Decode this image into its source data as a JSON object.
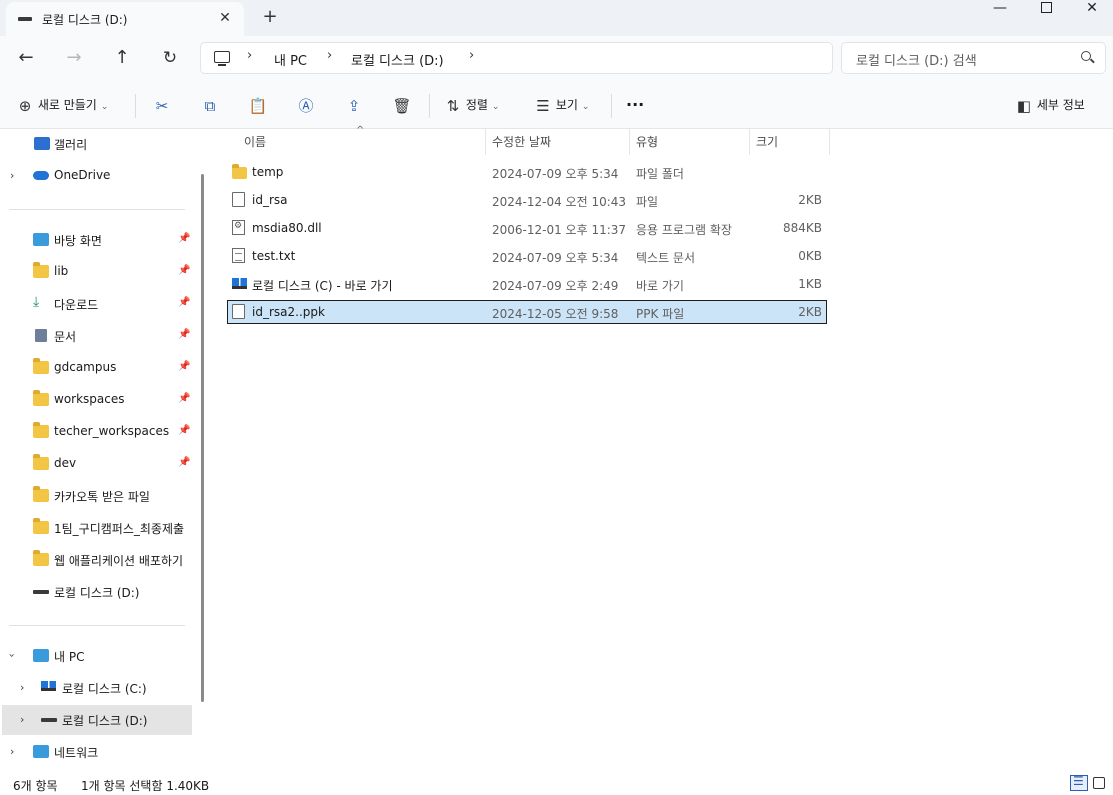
{
  "tab": {
    "title": "로컬 디스크 (D:)"
  },
  "breadcrumbs": [
    "내 PC",
    "로컬 디스크 (D:)"
  ],
  "search": {
    "placeholder": "로컬 디스크 (D:) 검색"
  },
  "toolbar": {
    "new_label": "새로 만들기",
    "sort_label": "정렬",
    "view_label": "보기",
    "more_label": "···",
    "details_label": "세부 정보"
  },
  "sidebar": {
    "gallery": "갤러리",
    "onedrive": "OneDrive",
    "quick": [
      {
        "label": "바탕 화면",
        "pinned": true
      },
      {
        "label": "lib",
        "pinned": true
      },
      {
        "label": "다운로드",
        "pinned": true
      },
      {
        "label": "문서",
        "pinned": true
      },
      {
        "label": "gdcampus",
        "pinned": true
      },
      {
        "label": "workspaces",
        "pinned": true
      },
      {
        "label": "techer_workspaces",
        "pinned": true
      },
      {
        "label": "dev",
        "pinned": true
      },
      {
        "label": "카카오톡 받은 파일",
        "pinned": false
      },
      {
        "label": "1팀_구디캠퍼스_최종제출",
        "pinned": false
      },
      {
        "label": "웹 애플리케이션 배포하기",
        "pinned": false
      },
      {
        "label": "로컬 디스크 (D:)",
        "pinned": false
      }
    ],
    "thispc": "내 PC",
    "drive_c": "로컬 디스크 (C:)",
    "drive_d": "로컬 디스크 (D:)",
    "network": "네트워크"
  },
  "columns": {
    "name": "이름",
    "modified": "수정한 날짜",
    "type": "유형",
    "size": "크기"
  },
  "files": [
    {
      "name": "temp",
      "modified": "2024-07-09 오후 5:34",
      "type": "파일 폴더",
      "size": "",
      "icon": "folder-icon"
    },
    {
      "name": "id_rsa",
      "modified": "2024-12-04 오전 10:43",
      "type": "파일",
      "size": "2KB",
      "icon": "file-icon"
    },
    {
      "name": "msdia80.dll",
      "modified": "2006-12-01 오후 11:37",
      "type": "응용 프로그램 확장",
      "size": "884KB",
      "icon": "dll-icon"
    },
    {
      "name": "test.txt",
      "modified": "2024-07-09 오후 5:34",
      "type": "텍스트 문서",
      "size": "0KB",
      "icon": "text-file-icon"
    },
    {
      "name": "로컬 디스크 (C) - 바로 가기",
      "modified": "2024-07-09 오후 2:49",
      "type": "바로 가기",
      "size": "1KB",
      "icon": "shortcut-icon"
    },
    {
      "name": "id_rsa2..ppk",
      "modified": "2024-12-05 오전 9:58",
      "type": "PPK 파일",
      "size": "2KB",
      "icon": "file-icon",
      "selected": true
    }
  ],
  "status": {
    "count": "6개 항목",
    "selection": "1개 항목 선택함 1.40KB"
  },
  "colors": {
    "accent": "#2b5fb3",
    "selection": "#cce4f7",
    "folder": "#f3c544"
  }
}
